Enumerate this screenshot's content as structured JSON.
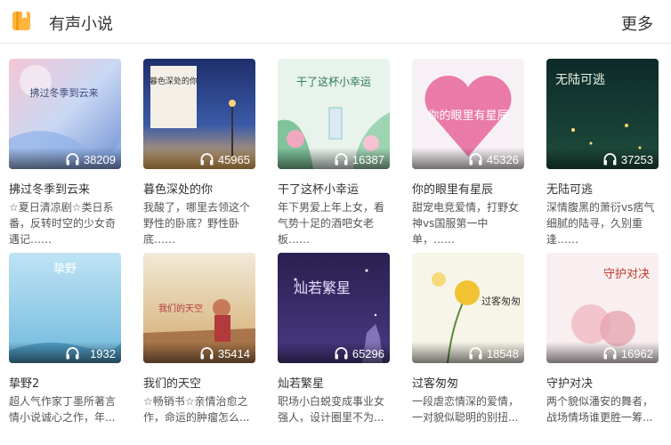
{
  "header": {
    "title": "有声小说",
    "more_label": "更多"
  },
  "books": [
    {
      "title": "拂过冬季到云来",
      "cover_text": "拂过冬季到云来",
      "plays": "38209",
      "desc": "☆夏日清凉剧☆类日系番，反转时空的少女奇遇记……"
    },
    {
      "title": "暮色深处的你",
      "cover_text": "暮色深处的你",
      "plays": "45965",
      "desc": "我酸了，哪里去领这个野性的卧底？野性卧底……"
    },
    {
      "title": "干了这杯小幸运",
      "cover_text": "干了这杯小幸运",
      "plays": "16387",
      "desc": "年下男爱上年上女，看气势十足的酒吧女老板……"
    },
    {
      "title": "你的眼里有星辰",
      "cover_text": "你的眼里有星辰",
      "plays": "45326",
      "desc": "甜宠电竞爱情，打野女神vs国服第一中单，……"
    },
    {
      "title": "无陆可逃",
      "cover_text": "无陆可逃",
      "plays": "37253",
      "desc": "深情腹黑的萧衍vs痞气细腻的陆寻，久别重逢……"
    },
    {
      "title": "挚野2",
      "cover_text": "挚野",
      "plays": "1932",
      "desc": "超人气作家丁墨所著言情小说诚心之作，年..."
    },
    {
      "title": "我们的天空",
      "cover_text": "我们的天空",
      "plays": "35414",
      "desc": "☆畅销书☆亲情治愈之作，命运的肿瘤怎么..."
    },
    {
      "title": "灿若繁星",
      "cover_text": "灿若繁星",
      "plays": "65296",
      "desc": "职场小白蜕变成事业女强人，设计圈里不为..."
    },
    {
      "title": "过客匆匆",
      "cover_text": "过客匆匆",
      "plays": "18548",
      "desc": "一段虐恋情深的爱情，一对貌似聪明的别扭..."
    },
    {
      "title": "守护对决",
      "cover_text": "守护对决",
      "plays": "16962",
      "desc": "两个貌似潘安的舞者，战场情场谁更胜一筹..."
    }
  ],
  "colors": {
    "text": "#333333",
    "accent": "#ffb53e"
  }
}
